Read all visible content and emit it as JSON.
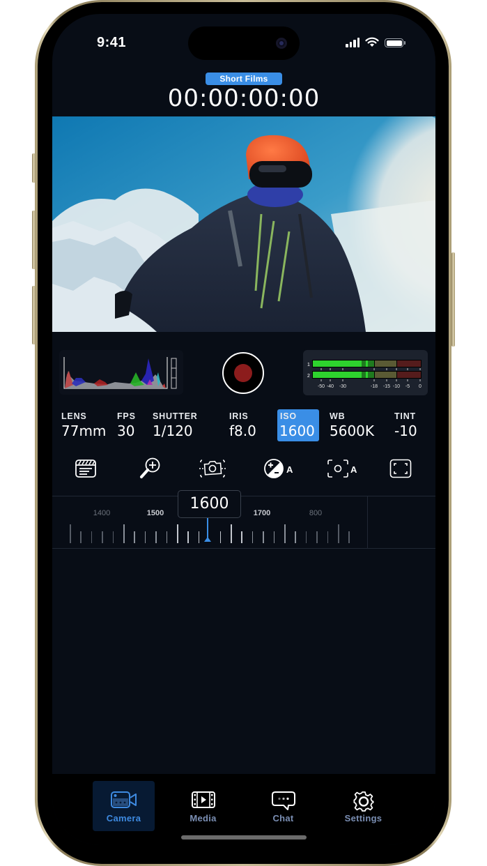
{
  "status_bar": {
    "time": "9:41",
    "signal_bars": 4,
    "wifi": "wifi-icon",
    "battery_level": 1.0
  },
  "header": {
    "project_badge": "Short Films",
    "timecode": "00:00:00:00"
  },
  "preview": {
    "description": "Snowboarder with orange helmet and goggles on snowy mountain, blue sky"
  },
  "histogram": {
    "label": "histogram"
  },
  "record": {
    "state": "idle",
    "color": "#8c1c1c"
  },
  "audio_meter": {
    "channels": [
      {
        "id": "1",
        "level_db": -16
      },
      {
        "id": "2",
        "level_db": -16
      }
    ],
    "scale": [
      "-50",
      "-40",
      "-30",
      "-18",
      "-15",
      "-10",
      "-5",
      "0"
    ]
  },
  "params": [
    {
      "label": "LENS",
      "value": "77mm",
      "active": false
    },
    {
      "label": "FPS",
      "value": "30",
      "active": false
    },
    {
      "label": "SHUTTER",
      "value": "1/120",
      "active": false
    },
    {
      "label": "IRIS",
      "value": "f8.0",
      "active": false
    },
    {
      "label": "ISO",
      "value": "1600",
      "active": true
    },
    {
      "label": "WB",
      "value": "5600K",
      "active": false
    },
    {
      "label": "TINT",
      "value": "-10",
      "active": false
    }
  ],
  "tools": [
    {
      "name": "clapperboard-icon"
    },
    {
      "name": "zoom-in-icon"
    },
    {
      "name": "stabilize-camera-icon"
    },
    {
      "name": "auto-exposure-icon",
      "suffix": "A"
    },
    {
      "name": "auto-focus-icon",
      "suffix": "A"
    },
    {
      "name": "frame-guides-icon"
    }
  ],
  "iso_ruler": {
    "current_value": "1600",
    "labels": [
      {
        "text": "1400",
        "emphasis": false
      },
      {
        "text": "1500",
        "emphasis": true
      },
      {
        "text": "1700",
        "emphasis": true
      },
      {
        "text": "800",
        "emphasis": false
      }
    ]
  },
  "tabbar": {
    "tabs": [
      {
        "label": "Camera",
        "icon": "video-camera-icon",
        "active": true
      },
      {
        "label": "Media",
        "icon": "film-icon",
        "active": false
      },
      {
        "label": "Chat",
        "icon": "chat-bubble-icon",
        "active": false
      },
      {
        "label": "Settings",
        "icon": "gear-icon",
        "active": false
      }
    ]
  },
  "colors": {
    "accent": "#3a8ee6",
    "background": "#080d16",
    "record": "#8c1c1c",
    "tab_active_bg": "#071a33"
  }
}
